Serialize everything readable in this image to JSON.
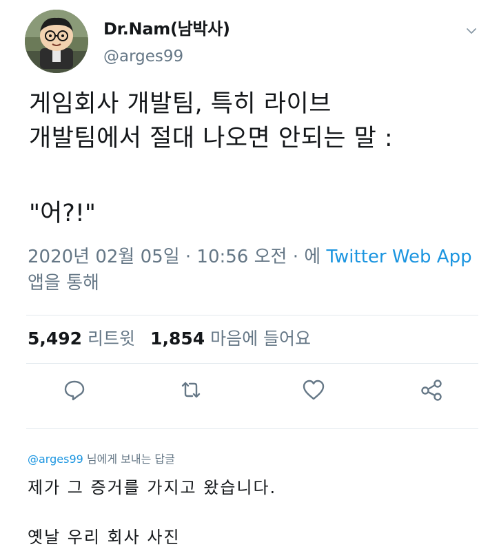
{
  "author": {
    "display_name": "Dr.Nam(남박사)",
    "handle": "@arges99"
  },
  "tweet": {
    "line1": "게임회사 개발팀, 특히 라이브",
    "line2": "개발팀에서 절대 나오면 안되는 말 :",
    "quote": "\"어?!\""
  },
  "meta": {
    "date": "2020년 02월 05일 · 10:56 오전 · 에 ",
    "source": "Twitter Web App",
    "suffix": " 앱을 통해"
  },
  "stats": {
    "retweets_count": "5,492",
    "retweets_label": "리트윗",
    "likes_count": "1,854",
    "likes_label": "마음에 들어요"
  },
  "icons": {
    "reply": "reply-icon",
    "retweet": "retweet-icon",
    "like": "heart-icon",
    "share": "share-icon",
    "menu": "chevron-down-icon"
  },
  "reply": {
    "to_handle": "@arges99",
    "to_label": " 님에게 보내는 답글",
    "line1": "제가 그 증거를 가지고 왔습니다.",
    "line2": "옛날 우리 회사 사진"
  },
  "colors": {
    "text": "#14171a",
    "muted": "#657786",
    "link": "#1b95e0",
    "border": "#e1e8ed"
  }
}
